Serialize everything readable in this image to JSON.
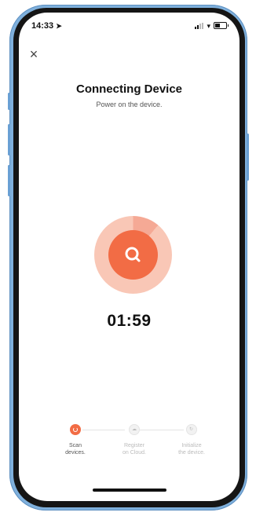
{
  "status_bar": {
    "time": "14:33",
    "location_arrow": "location-arrow-icon"
  },
  "header": {
    "close_icon": "close-icon",
    "title": "Connecting Device",
    "subtitle": "Power on the device."
  },
  "scanner": {
    "icon": "search-icon",
    "timer": "01:59",
    "accent_color": "#f26c45"
  },
  "steps": [
    {
      "label_line1": "Scan",
      "label_line2": "devices.",
      "state": "active"
    },
    {
      "label_line1": "Register",
      "label_line2": "on Cloud.",
      "state": "pending"
    },
    {
      "label_line1": "Initialize",
      "label_line2": "the device.",
      "state": "pending"
    }
  ]
}
